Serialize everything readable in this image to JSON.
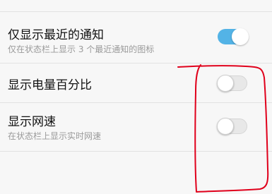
{
  "settings": {
    "items": [
      {
        "title": "仅显示最近的通知",
        "subtitle": "仅在状态栏上显示 3 个最近通知的图标",
        "enabled": true
      },
      {
        "title": "显示电量百分比",
        "subtitle": "",
        "enabled": false
      },
      {
        "title": "显示网速",
        "subtitle": "在状态栏上显示实时网速",
        "enabled": false
      }
    ]
  },
  "colors": {
    "background": "#f7f7f7",
    "switch_on": "#53b3e6",
    "switch_off": "#e8e8e8",
    "annotation": "#e0001b"
  }
}
